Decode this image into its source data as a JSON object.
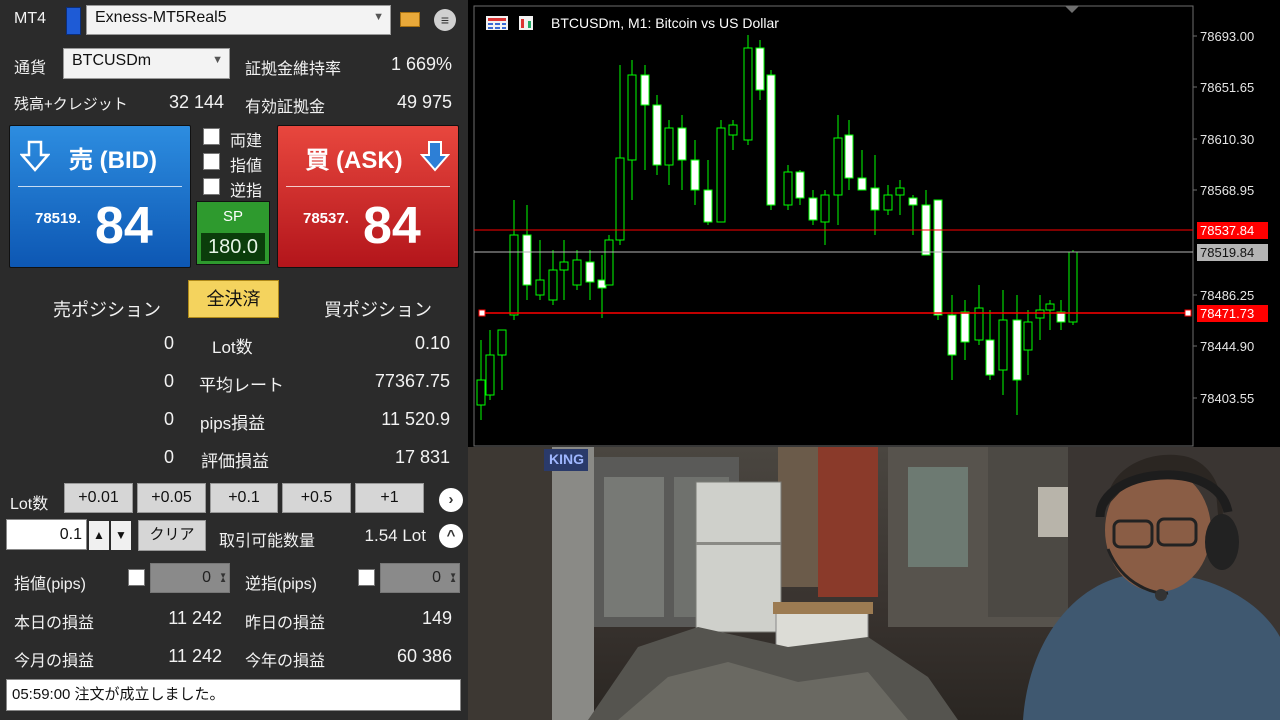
{
  "panel": {
    "platform_label": "MT4",
    "account": "Exness-MT5Real5",
    "currency_label": "通貨",
    "symbol": "BTCUSDm",
    "margin_level_label": "証拠金維持率",
    "margin_level": "1 669%",
    "balance_label": "残高+クレジット",
    "balance": "32 144",
    "equity_label": "有効証拠金",
    "equity": "49 975",
    "bid": {
      "title": "売 (BID)",
      "price_prefix": "78519.",
      "price_main": "84"
    },
    "ask": {
      "title": "買 (ASK)",
      "price_prefix": "78537.",
      "price_main": "84"
    },
    "checks": [
      "両建",
      "指値",
      "逆指"
    ],
    "spread_label": "SP",
    "spread": "180.0",
    "sell_positions_label": "売ポジション",
    "close_all_label": "全決済",
    "buy_positions_label": "買ポジション",
    "rows": [
      {
        "left": "0",
        "label": "Lot数",
        "right": "0.10"
      },
      {
        "left": "0",
        "label": "平均レート",
        "right": "77367.75"
      },
      {
        "left": "0",
        "label": "pips損益",
        "right": "11 520.9"
      },
      {
        "left": "0",
        "label": "評価損益",
        "right": "17 831"
      }
    ],
    "lot_label": "Lot数",
    "lot_steps": [
      "+0.01",
      "+0.05",
      "+0.1",
      "+0.5",
      "+1"
    ],
    "lot_value": "0.1",
    "clear_label": "クリア",
    "tradable_label": "取引可能数量",
    "tradable_value": "1.54 Lot",
    "limit_label": "指値(pips)",
    "limit_value": "0",
    "stop_label": "逆指(pips)",
    "stop_value": "0",
    "today_label": "本日の損益",
    "today_value": "11 242",
    "yesterday_label": "昨日の損益",
    "yesterday_value": "149",
    "month_label": "今月の損益",
    "month_value": "11 242",
    "year_label": "今年の損益",
    "year_value": "60 386",
    "status": "05:59:00 注文が成立しました。"
  },
  "chart": {
    "title": "BTCUSDm, M1:  Bitcoin vs US Dollar",
    "y_ticks": [
      "78693.00",
      "78651.65",
      "78610.30",
      "78568.95",
      "78486.25",
      "78444.90",
      "78403.55"
    ],
    "ask_tag": "78537.84",
    "bid_tag": "78519.84",
    "position_tag": "78471.73",
    "colors": {
      "bull": "#00ff00",
      "bear": "#ffffff",
      "ask_line": "#ff0000",
      "bid_line": "#b4b4b4",
      "pos_line": "#ff0000"
    }
  },
  "video": {
    "sign_text": "KING"
  }
}
